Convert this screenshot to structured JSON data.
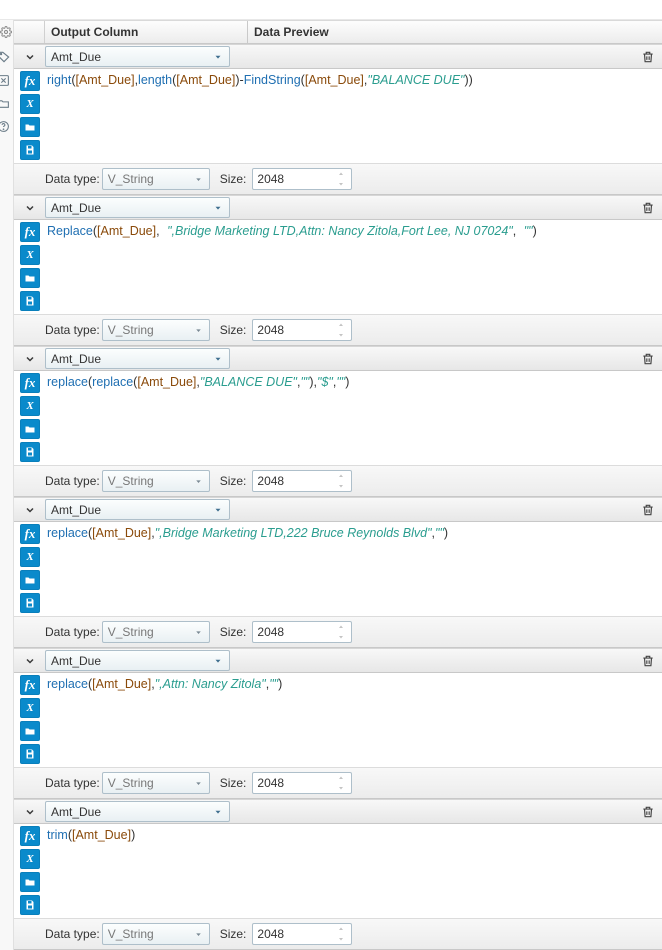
{
  "title_bar": "",
  "header": {
    "output_column": "Output Column",
    "data_preview": "Data Preview"
  },
  "labels": {
    "data_type": "Data type:",
    "size": "Size:"
  },
  "data_type_options": [
    "V_String"
  ],
  "rows": [
    {
      "field": "Amt_Due",
      "data_type": "V_String",
      "size": "2048",
      "expr_html": "<span class='fn'>right</span><span class='paren'>(</span><span class='field'>[Amt_Due]</span><span class='punct'>,</span><span class='fn'>length</span><span class='paren'>(</span><span class='field'>[Amt_Due]</span><span class='paren'>)</span><span class='punct'>-</span><span class='fn'>FindString</span><span class='paren'>(</span><span class='field'>[Amt_Due]</span><span class='punct'>,</span><span class='str'>\"BALANCE DUE\"</span><span class='paren'>)</span><span class='paren'>)</span>"
    },
    {
      "field": "Amt_Due",
      "data_type": "V_String",
      "size": "2048",
      "expr_html": "<span class='fn'>Replace</span><span class='paren'>(</span><span class='field'>[Amt_Due]</span><span class='punct'>,</span> <span class='str'>\",Bridge Marketing LTD,Attn: Nancy Zitola,Fort Lee, NJ 07024\"</span><span class='punct'>,</span> <span class='str'>\"\"</span><span class='paren'>)</span>"
    },
    {
      "field": "Amt_Due",
      "data_type": "V_String",
      "size": "2048",
      "expr_html": "<span class='fn'>replace</span><span class='paren'>(</span><span class='fn'>replace</span><span class='paren'>(</span><span class='field'>[Amt_Due]</span><span class='punct'>,</span><span class='str'>\"BALANCE DUE\"</span><span class='punct'>,</span><span class='str'>\"\"</span><span class='paren'>)</span><span class='punct'>,</span><span class='str'>\"$\"</span><span class='punct'>,</span><span class='str'>\"\"</span><span class='paren'>)</span>"
    },
    {
      "field": "Amt_Due",
      "data_type": "V_String",
      "size": "2048",
      "expr_html": "<span class='fn'>replace</span><span class='paren'>(</span><span class='field'>[Amt_Due]</span><span class='punct'>,</span><span class='str'>\",Bridge Marketing LTD,222 Bruce Reynolds Blvd\"</span><span class='punct'>,</span><span class='str'>\"\"</span><span class='paren'>)</span>"
    },
    {
      "field": "Amt_Due",
      "data_type": "V_String",
      "size": "2048",
      "expr_html": "<span class='fn'>replace</span><span class='paren'>(</span><span class='field'>[Amt_Due]</span><span class='punct'>,</span><span class='str'>\",Attn: Nancy Zitola\"</span><span class='punct'>,</span><span class='str'>\"\"</span><span class='paren'>)</span>"
    },
    {
      "field": "Amt_Due",
      "data_type": "V_String",
      "size": "2048",
      "expr_html": "<span class='fn'>trim</span><span class='paren'>(</span><span class='field'>[Amt_Due]</span><span class='paren'>)</span>"
    }
  ]
}
